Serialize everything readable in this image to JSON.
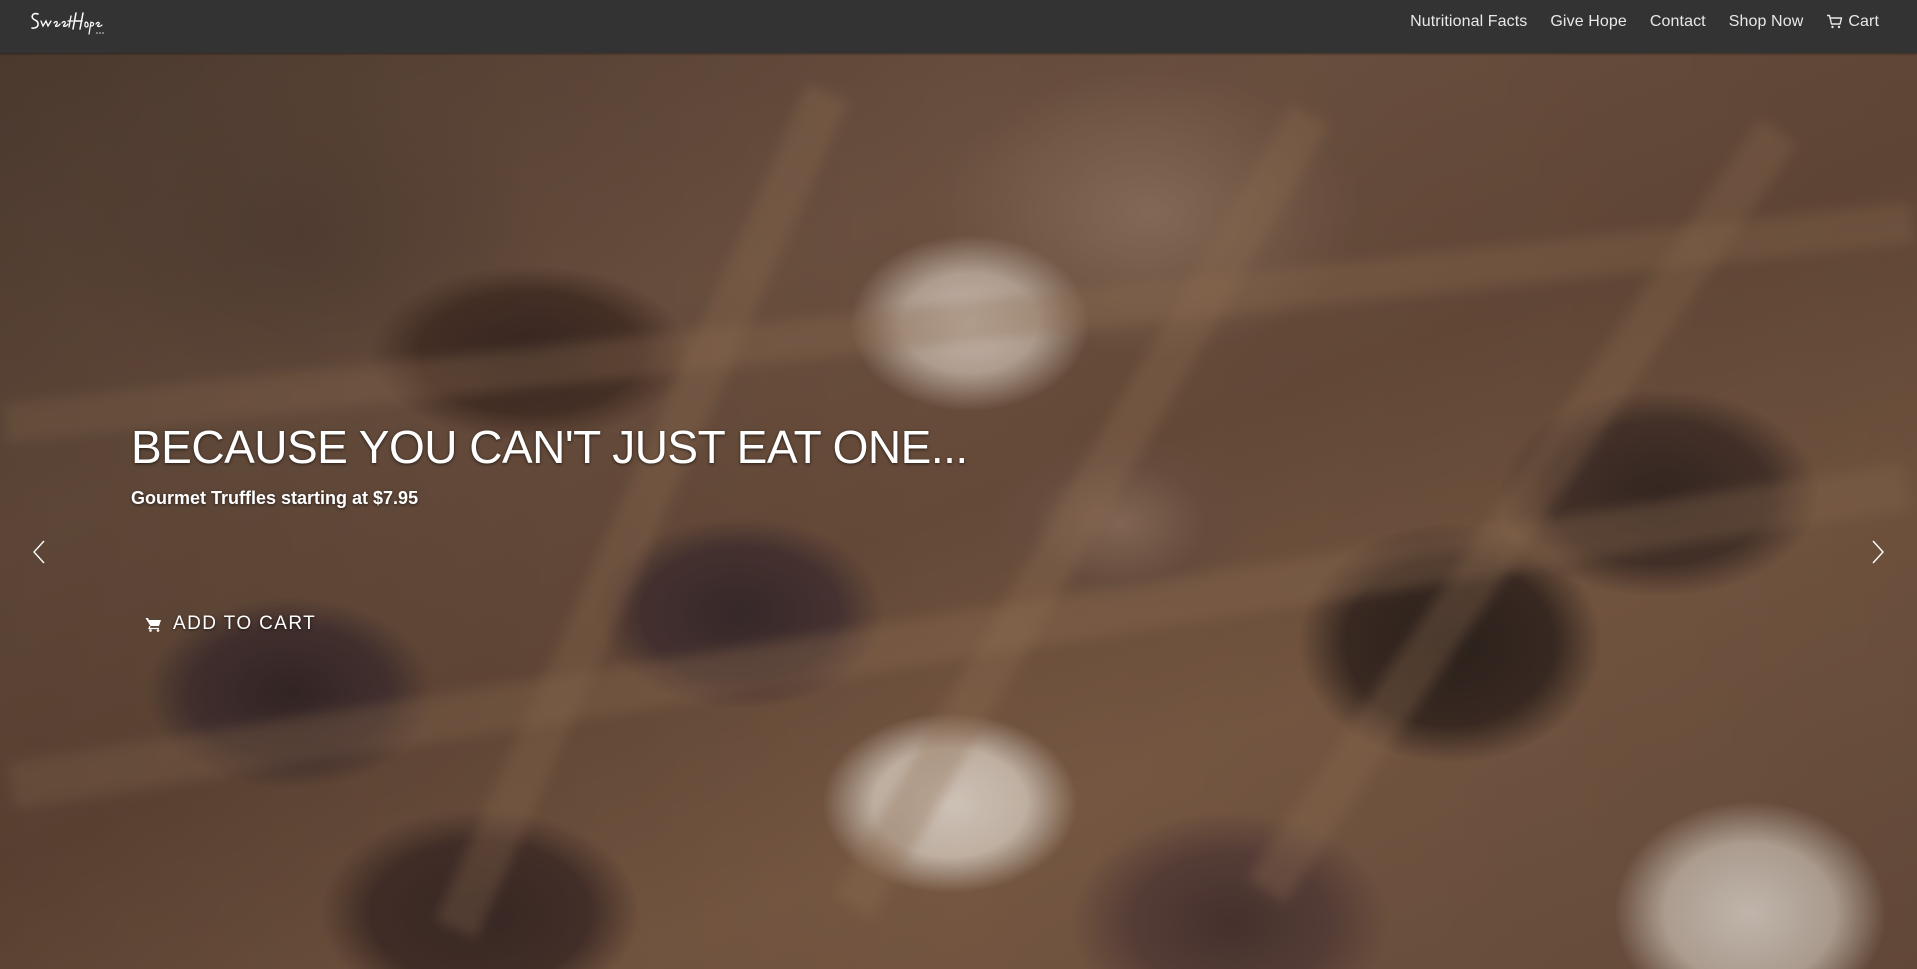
{
  "brand": {
    "logo_text": "Sweet Hope Inc."
  },
  "nav": {
    "items": [
      {
        "label": "Nutritional Facts"
      },
      {
        "label": "Give Hope"
      },
      {
        "label": "Contact"
      },
      {
        "label": "Shop Now"
      },
      {
        "label": "Cart",
        "icon": "cart-icon"
      }
    ]
  },
  "hero": {
    "headline": "BECAUSE YOU CAN'T JUST EAT ONE...",
    "subheadline": "Gourmet Truffles starting at $7.95",
    "cta_label": "ADD TO CART",
    "cta_icon": "shopping-cart-icon",
    "prev_icon": "chevron-left-icon",
    "next_icon": "chevron-right-icon",
    "image_subject": "box of assorted chocolate truffles"
  },
  "colors": {
    "navbar_bg": "#333333",
    "nav_text": "#e8e8e8",
    "hero_text": "#ffffff"
  }
}
